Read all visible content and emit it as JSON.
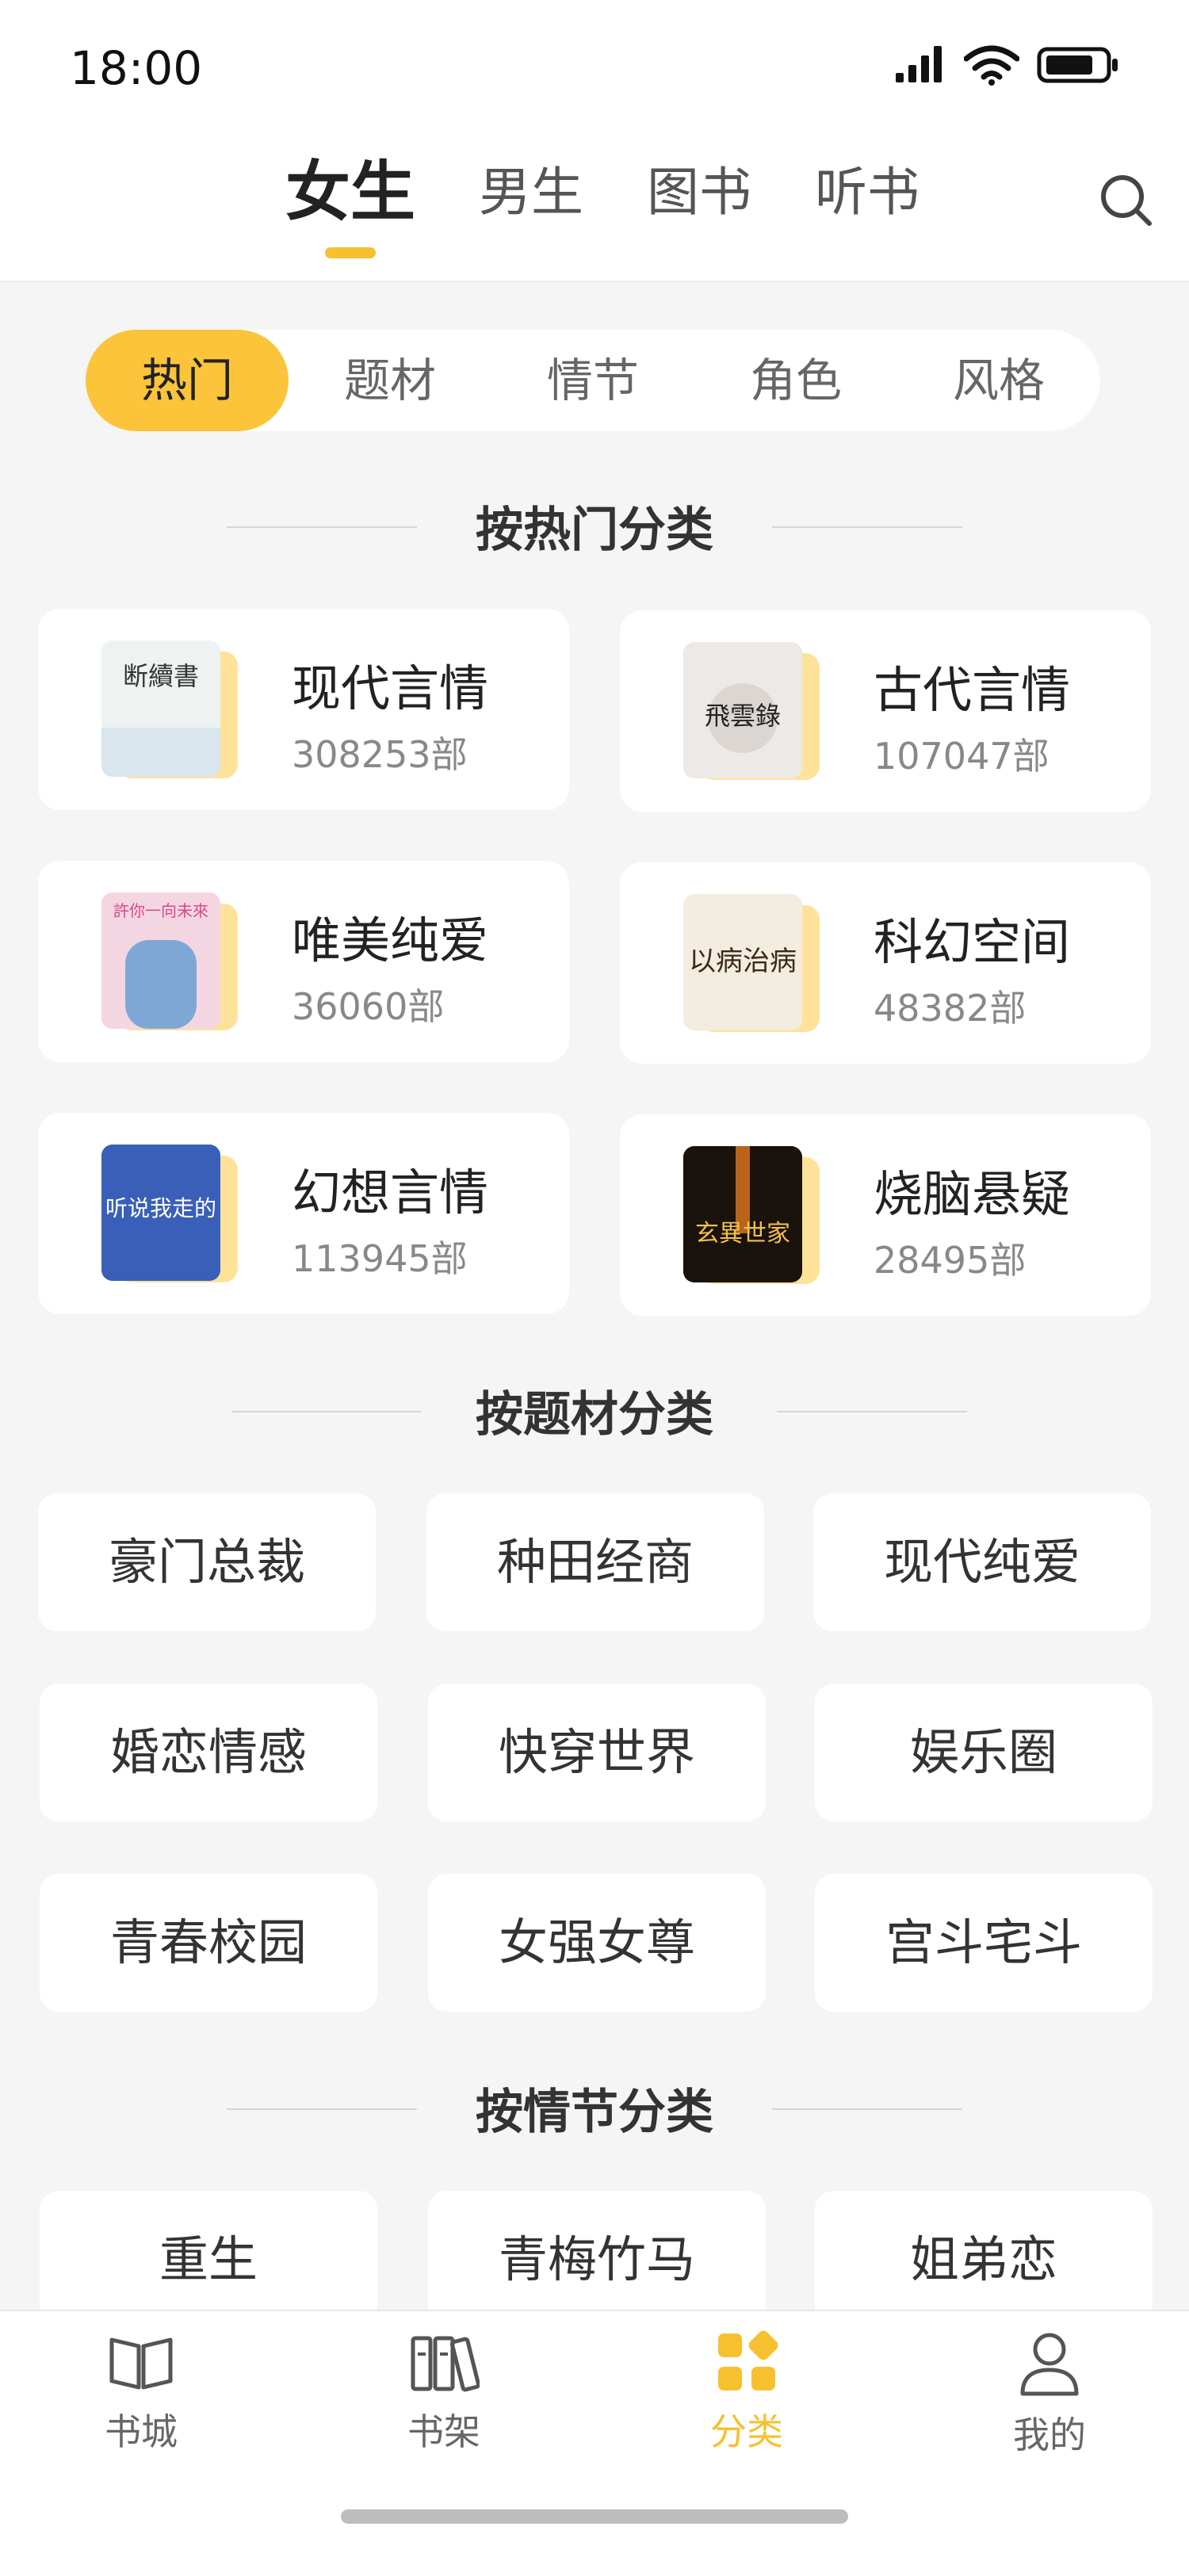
{
  "status": {
    "time": "18:00"
  },
  "header": {
    "tabs": [
      "女生",
      "男生",
      "图书",
      "听书"
    ],
    "active_tab": "女生",
    "search_icon": "search-icon"
  },
  "segmented": [
    "热门",
    "题材",
    "情节",
    "角色",
    "风格"
  ],
  "sections": {
    "hot_title": "按热门分类",
    "theme_title": "按题材分类",
    "plot_title": "按情节分类"
  },
  "hot_categories": [
    {
      "name": "现代言情",
      "count": "308253部",
      "cover_title": "断續書",
      "cover_color": "#eef3f1"
    },
    {
      "name": "古代言情",
      "count": "107047部",
      "cover_title": "飛雲錄",
      "cover_color": "#ece9e6"
    },
    {
      "name": "唯美纯爱",
      "count": "36060部",
      "cover_title": "許你一向未來",
      "cover_color": "#f4d6e3"
    },
    {
      "name": "科幻空间",
      "count": "48382部",
      "cover_title": "以病治病",
      "cover_color": "#f3ede0"
    },
    {
      "name": "幻想言情",
      "count": "113945部",
      "cover_title": "听说我走的",
      "cover_color": "#3a5fb8"
    },
    {
      "name": "烧脑悬疑",
      "count": "28495部",
      "cover_title": "玄異世家",
      "cover_color": "#2b1a10"
    }
  ],
  "theme_chips": [
    "豪门总裁",
    "种田经商",
    "现代纯爱",
    "婚恋情感",
    "快穿世界",
    "娱乐圈",
    "青春校园",
    "女强女尊",
    "宫斗宅斗"
  ],
  "plot_chips": [
    "重生",
    "青梅竹马",
    "姐弟恋"
  ],
  "bottom_nav": [
    {
      "label": "书城",
      "icon": "book-open-icon"
    },
    {
      "label": "书架",
      "icon": "bookshelf-icon"
    },
    {
      "label": "分类",
      "icon": "category-icon",
      "active": true
    },
    {
      "label": "我的",
      "icon": "profile-icon"
    }
  ],
  "colors": {
    "accent": "#fbc43a",
    "background": "#f5f5f5"
  }
}
